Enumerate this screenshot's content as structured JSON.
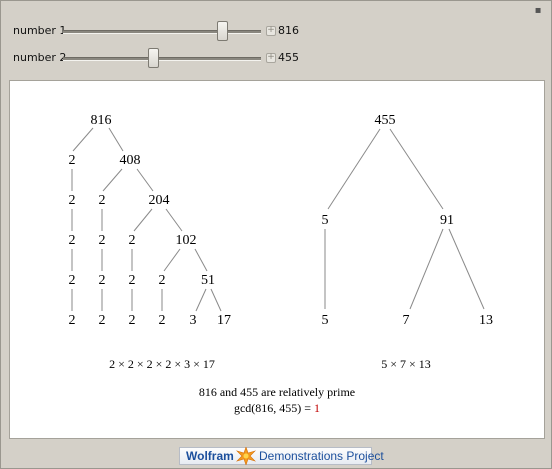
{
  "controls": {
    "number1": {
      "label": "number 1",
      "value": "816",
      "slider_fraction": 0.8
    },
    "number2": {
      "label": "number 2",
      "value": "455",
      "slider_fraction": 0.45
    },
    "plus_symbol": "+"
  },
  "window": {
    "close_symbol": "▪"
  },
  "left_tree": {
    "nodes": [
      "816",
      "2",
      "408",
      "2",
      "2",
      "204",
      "2",
      "2",
      "2",
      "102",
      "2",
      "2",
      "2",
      "2",
      "51",
      "2",
      "2",
      "2",
      "2",
      "3",
      "17"
    ],
    "factorization": "2 × 2 × 2 × 2 × 3 × 17"
  },
  "right_tree": {
    "nodes": [
      "455",
      "5",
      "91",
      "5",
      "7",
      "13"
    ],
    "factorization": "5 × 7 × 13"
  },
  "result": {
    "statement": "816 and 455 are relatively prime",
    "gcd_expr": "gcd(816, 455) = ",
    "gcd_value": "1"
  },
  "footer": {
    "wolfram": "Wolfram",
    "demonstrations": "Demonstrations Project"
  }
}
